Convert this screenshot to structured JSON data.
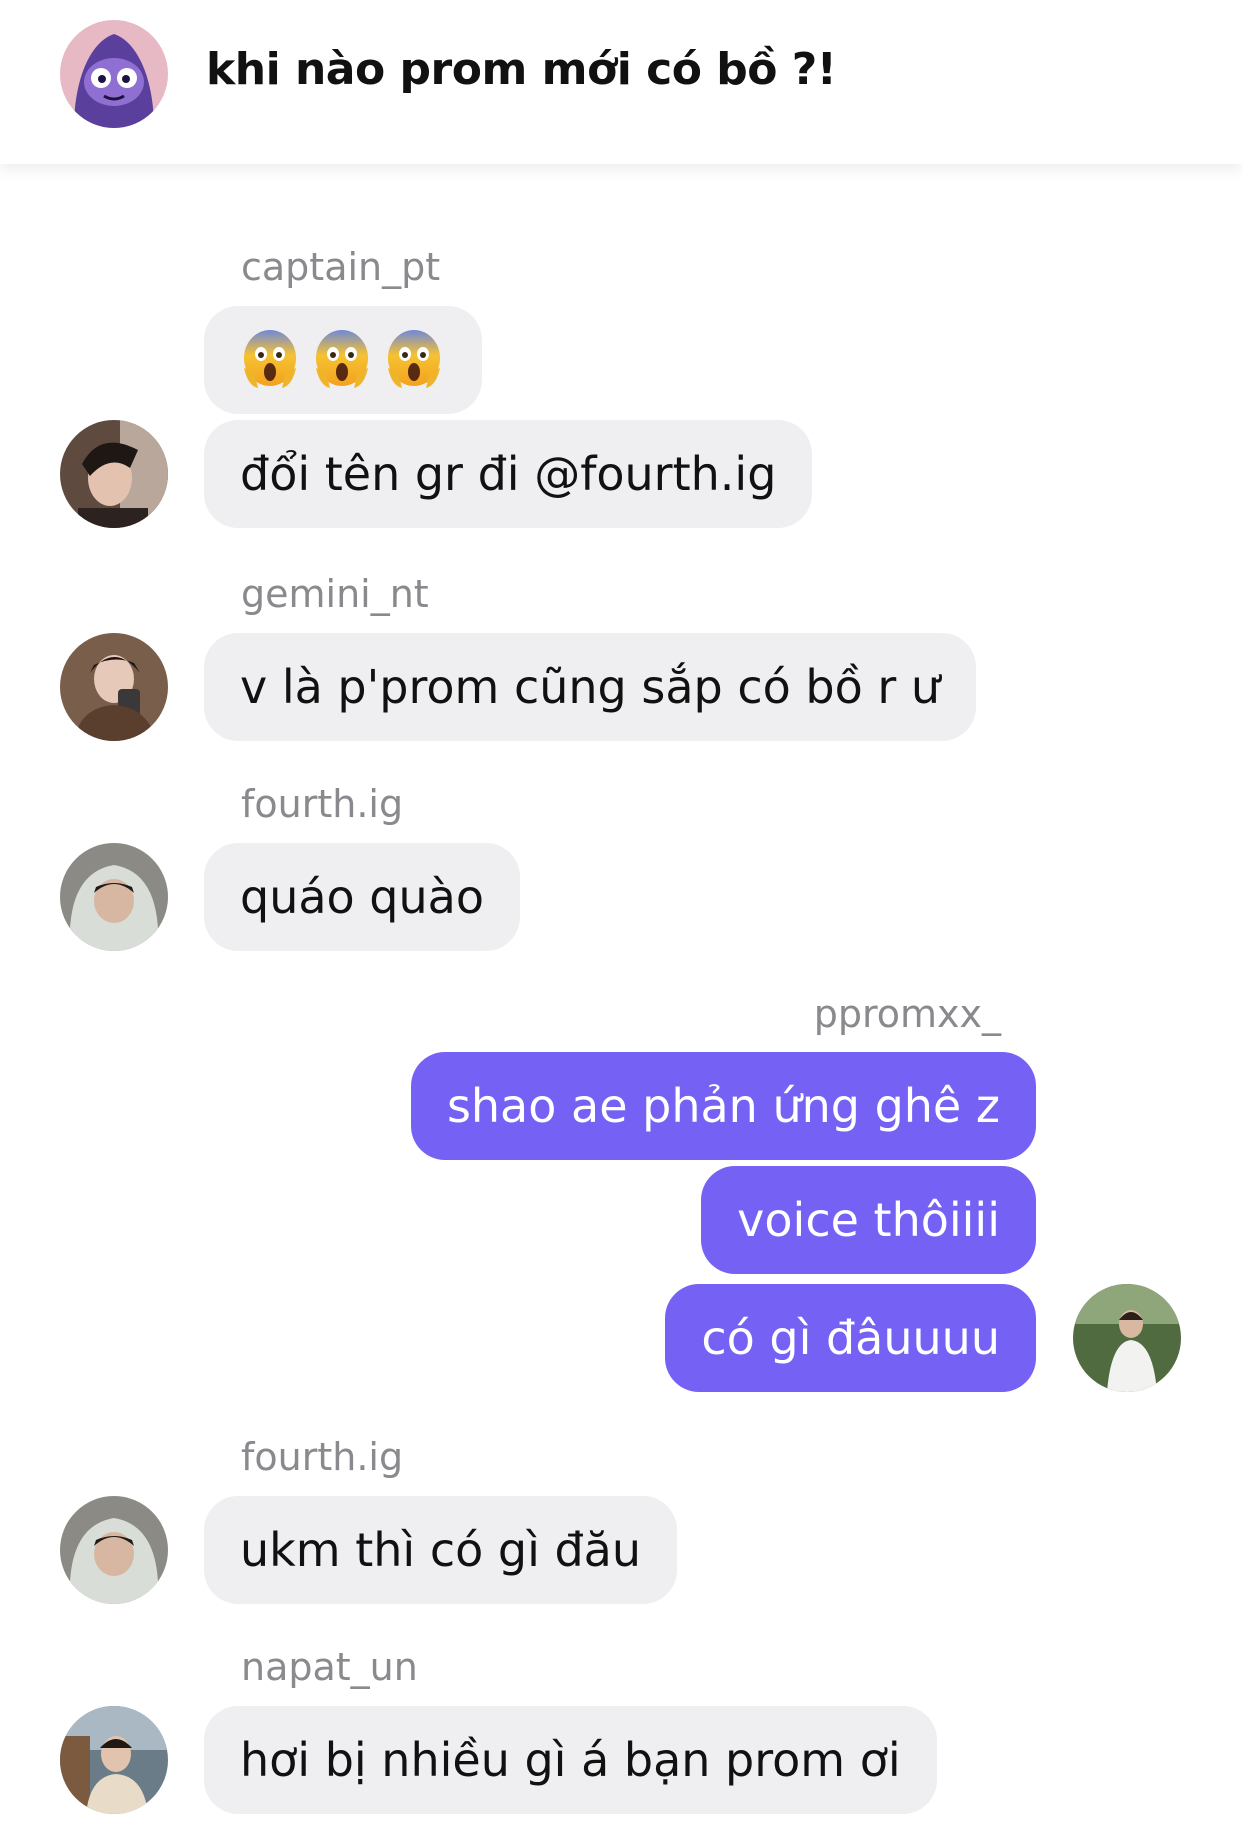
{
  "header": {
    "title": "khi nào prom mới có bồ ?!",
    "avatar_icon": "group-avatar-icon"
  },
  "colors": {
    "outgoing_bubble": "#7562f5",
    "incoming_bubble": "#efeff1",
    "sender_text": "#8a8a8e"
  },
  "messages": [
    {
      "sender": "captain_pt",
      "outgoing": false,
      "bubbles": [
        {
          "type": "emoji",
          "icon": "screaming-face-emoji",
          "count": 3
        },
        {
          "type": "text",
          "text": "đổi tên gr đi @fourth.ig"
        }
      ]
    },
    {
      "sender": "gemini_nt",
      "outgoing": false,
      "bubbles": [
        {
          "type": "text",
          "text": "v là p'prom cũng sắp có bồ r ư"
        }
      ]
    },
    {
      "sender": "fourth.ig",
      "outgoing": false,
      "bubbles": [
        {
          "type": "text",
          "text": "quáo quào"
        }
      ]
    },
    {
      "sender": "ppromxx_",
      "outgoing": true,
      "bubbles": [
        {
          "type": "text",
          "text": "shao ae phản ứng ghê z"
        },
        {
          "type": "text",
          "text": "voice thôiiii"
        },
        {
          "type": "text",
          "text": "có gì đâuuuu"
        }
      ]
    },
    {
      "sender": "fourth.ig",
      "outgoing": false,
      "bubbles": [
        {
          "type": "text",
          "text": "ukm thì có gì đău"
        }
      ]
    },
    {
      "sender": "napat_un",
      "outgoing": false,
      "bubbles": [
        {
          "type": "text",
          "text": "hơi bị nhiều gì á bạn prom ơi"
        }
      ]
    }
  ]
}
